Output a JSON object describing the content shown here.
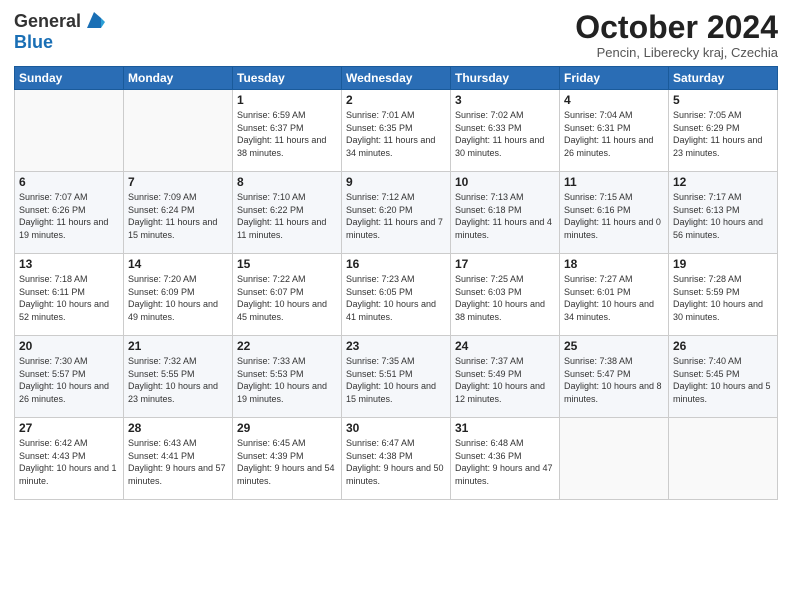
{
  "header": {
    "logo_line1": "General",
    "logo_line2": "Blue",
    "month": "October 2024",
    "location": "Pencin, Liberecky kraj, Czechia"
  },
  "days_of_week": [
    "Sunday",
    "Monday",
    "Tuesday",
    "Wednesday",
    "Thursday",
    "Friday",
    "Saturday"
  ],
  "weeks": [
    [
      {
        "day": "",
        "info": ""
      },
      {
        "day": "",
        "info": ""
      },
      {
        "day": "1",
        "info": "Sunrise: 6:59 AM\nSunset: 6:37 PM\nDaylight: 11 hours and 38 minutes."
      },
      {
        "day": "2",
        "info": "Sunrise: 7:01 AM\nSunset: 6:35 PM\nDaylight: 11 hours and 34 minutes."
      },
      {
        "day": "3",
        "info": "Sunrise: 7:02 AM\nSunset: 6:33 PM\nDaylight: 11 hours and 30 minutes."
      },
      {
        "day": "4",
        "info": "Sunrise: 7:04 AM\nSunset: 6:31 PM\nDaylight: 11 hours and 26 minutes."
      },
      {
        "day": "5",
        "info": "Sunrise: 7:05 AM\nSunset: 6:29 PM\nDaylight: 11 hours and 23 minutes."
      }
    ],
    [
      {
        "day": "6",
        "info": "Sunrise: 7:07 AM\nSunset: 6:26 PM\nDaylight: 11 hours and 19 minutes."
      },
      {
        "day": "7",
        "info": "Sunrise: 7:09 AM\nSunset: 6:24 PM\nDaylight: 11 hours and 15 minutes."
      },
      {
        "day": "8",
        "info": "Sunrise: 7:10 AM\nSunset: 6:22 PM\nDaylight: 11 hours and 11 minutes."
      },
      {
        "day": "9",
        "info": "Sunrise: 7:12 AM\nSunset: 6:20 PM\nDaylight: 11 hours and 7 minutes."
      },
      {
        "day": "10",
        "info": "Sunrise: 7:13 AM\nSunset: 6:18 PM\nDaylight: 11 hours and 4 minutes."
      },
      {
        "day": "11",
        "info": "Sunrise: 7:15 AM\nSunset: 6:16 PM\nDaylight: 11 hours and 0 minutes."
      },
      {
        "day": "12",
        "info": "Sunrise: 7:17 AM\nSunset: 6:13 PM\nDaylight: 10 hours and 56 minutes."
      }
    ],
    [
      {
        "day": "13",
        "info": "Sunrise: 7:18 AM\nSunset: 6:11 PM\nDaylight: 10 hours and 52 minutes."
      },
      {
        "day": "14",
        "info": "Sunrise: 7:20 AM\nSunset: 6:09 PM\nDaylight: 10 hours and 49 minutes."
      },
      {
        "day": "15",
        "info": "Sunrise: 7:22 AM\nSunset: 6:07 PM\nDaylight: 10 hours and 45 minutes."
      },
      {
        "day": "16",
        "info": "Sunrise: 7:23 AM\nSunset: 6:05 PM\nDaylight: 10 hours and 41 minutes."
      },
      {
        "day": "17",
        "info": "Sunrise: 7:25 AM\nSunset: 6:03 PM\nDaylight: 10 hours and 38 minutes."
      },
      {
        "day": "18",
        "info": "Sunrise: 7:27 AM\nSunset: 6:01 PM\nDaylight: 10 hours and 34 minutes."
      },
      {
        "day": "19",
        "info": "Sunrise: 7:28 AM\nSunset: 5:59 PM\nDaylight: 10 hours and 30 minutes."
      }
    ],
    [
      {
        "day": "20",
        "info": "Sunrise: 7:30 AM\nSunset: 5:57 PM\nDaylight: 10 hours and 26 minutes."
      },
      {
        "day": "21",
        "info": "Sunrise: 7:32 AM\nSunset: 5:55 PM\nDaylight: 10 hours and 23 minutes."
      },
      {
        "day": "22",
        "info": "Sunrise: 7:33 AM\nSunset: 5:53 PM\nDaylight: 10 hours and 19 minutes."
      },
      {
        "day": "23",
        "info": "Sunrise: 7:35 AM\nSunset: 5:51 PM\nDaylight: 10 hours and 15 minutes."
      },
      {
        "day": "24",
        "info": "Sunrise: 7:37 AM\nSunset: 5:49 PM\nDaylight: 10 hours and 12 minutes."
      },
      {
        "day": "25",
        "info": "Sunrise: 7:38 AM\nSunset: 5:47 PM\nDaylight: 10 hours and 8 minutes."
      },
      {
        "day": "26",
        "info": "Sunrise: 7:40 AM\nSunset: 5:45 PM\nDaylight: 10 hours and 5 minutes."
      }
    ],
    [
      {
        "day": "27",
        "info": "Sunrise: 6:42 AM\nSunset: 4:43 PM\nDaylight: 10 hours and 1 minute."
      },
      {
        "day": "28",
        "info": "Sunrise: 6:43 AM\nSunset: 4:41 PM\nDaylight: 9 hours and 57 minutes."
      },
      {
        "day": "29",
        "info": "Sunrise: 6:45 AM\nSunset: 4:39 PM\nDaylight: 9 hours and 54 minutes."
      },
      {
        "day": "30",
        "info": "Sunrise: 6:47 AM\nSunset: 4:38 PM\nDaylight: 9 hours and 50 minutes."
      },
      {
        "day": "31",
        "info": "Sunrise: 6:48 AM\nSunset: 4:36 PM\nDaylight: 9 hours and 47 minutes."
      },
      {
        "day": "",
        "info": ""
      },
      {
        "day": "",
        "info": ""
      }
    ]
  ]
}
